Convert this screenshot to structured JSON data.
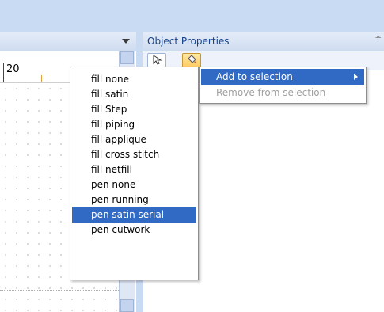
{
  "ruler": {
    "tick_label": "20"
  },
  "object_properties": {
    "title": "Object Properties",
    "pin_glyph": "⍑"
  },
  "context_menu": {
    "items": [
      {
        "label": "fill none"
      },
      {
        "label": "fill satin"
      },
      {
        "label": "fill Step"
      },
      {
        "label": "fill piping"
      },
      {
        "label": "fill applique"
      },
      {
        "label": "fill cross stitch"
      },
      {
        "label": "fill netfill"
      },
      {
        "label": "pen none"
      },
      {
        "label": "pen running"
      },
      {
        "label": "pen satin serial",
        "selected": true
      },
      {
        "label": "pen cutwork"
      }
    ]
  },
  "submenu": {
    "items": [
      {
        "label": "Add to selection",
        "highlighted": true
      },
      {
        "label": "Remove from selection",
        "disabled": true
      }
    ]
  },
  "colors": {
    "selection": "#316ac5",
    "panel_title": "#15428b",
    "frame_blue": "#c9daf3"
  }
}
